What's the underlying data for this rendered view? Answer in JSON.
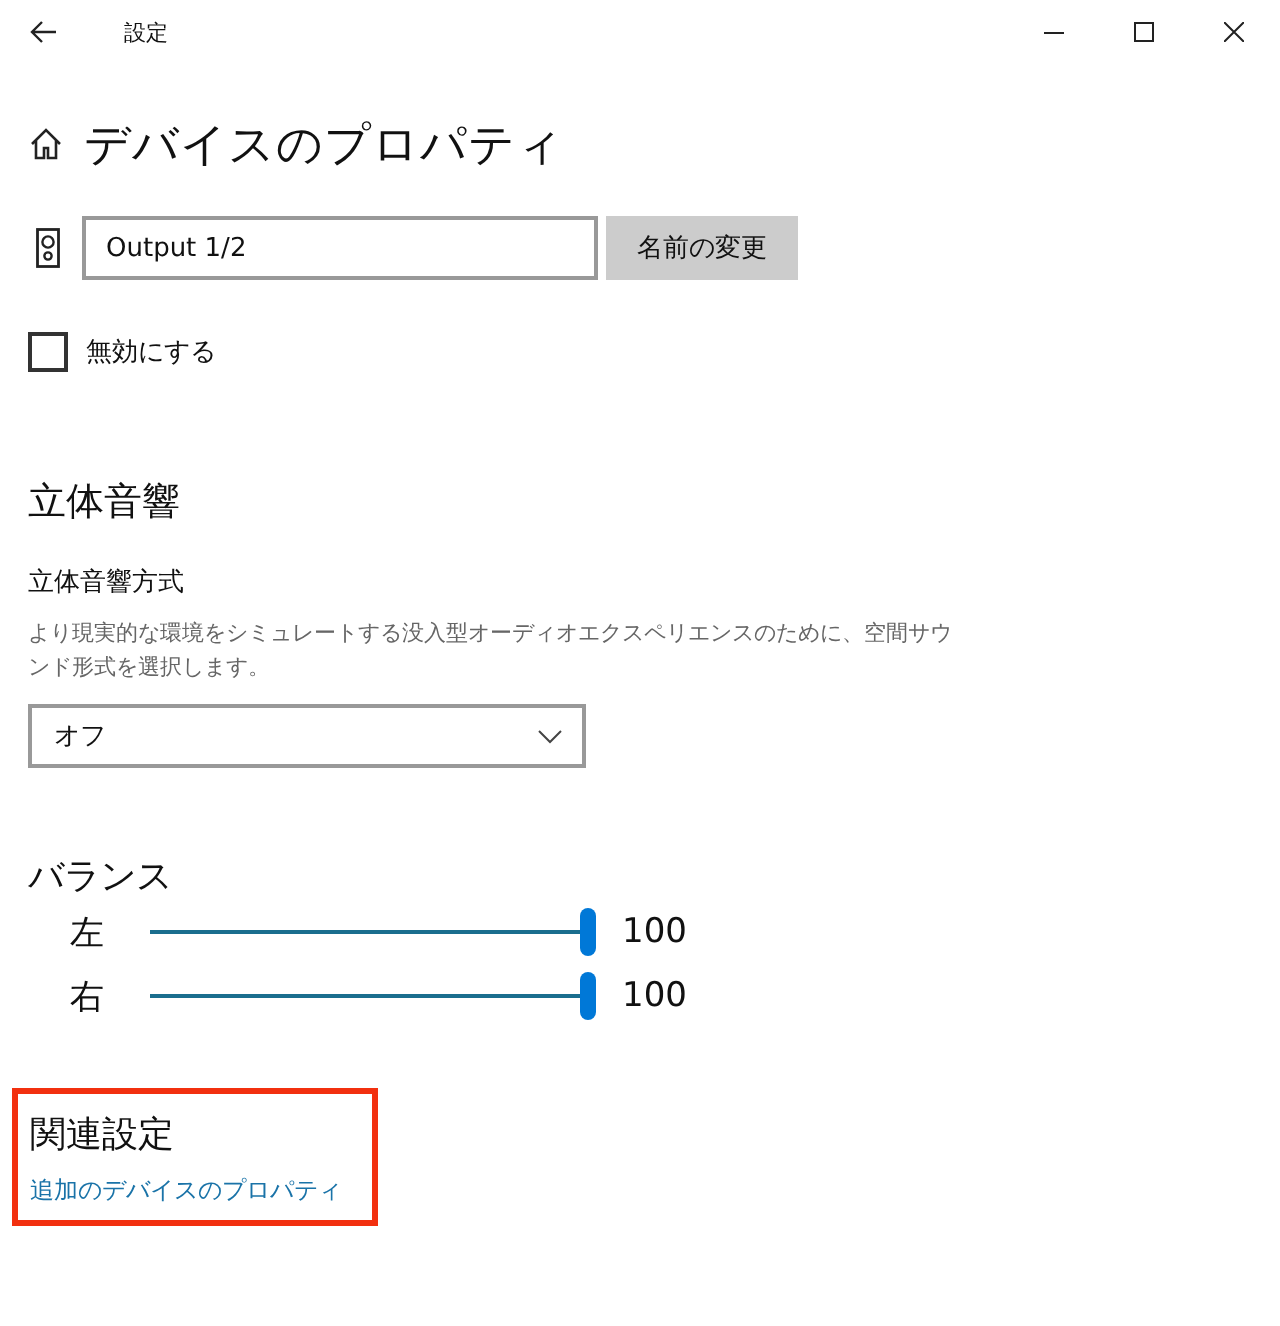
{
  "window": {
    "title": "設定"
  },
  "page_title": "デバイスのプロパティ",
  "device": {
    "name_value": "Output 1/2",
    "rename_button": "名前の変更"
  },
  "disable": {
    "label": "無効にする",
    "checked": false
  },
  "spatial": {
    "heading": "立体音響",
    "label": "立体音響方式",
    "description": "より現実的な環境をシミュレートする没入型オーディオエクスペリエンスのために、空間サウンド形式を選択します。",
    "selected_option": "オフ"
  },
  "balance": {
    "heading": "バランス",
    "channels": [
      {
        "name": "左",
        "level": 1,
        "reading": "100"
      },
      {
        "name": "右",
        "level": 1,
        "reading": "100"
      }
    ]
  },
  "related": {
    "heading": "関連設定",
    "link": "追加のデバイスのプロパティ",
    "highlighted": true
  }
}
